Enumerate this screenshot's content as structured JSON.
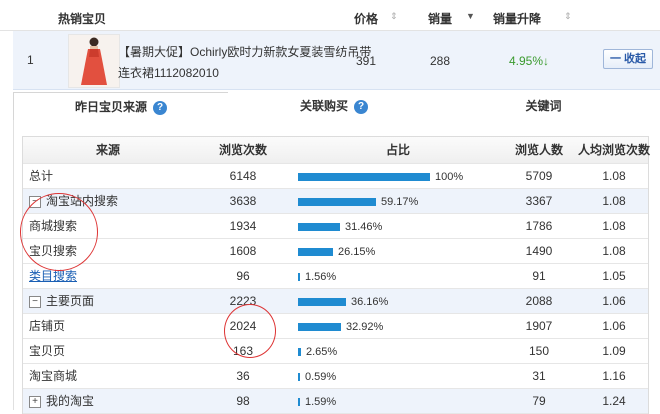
{
  "header": {
    "col_product": "热销宝贝",
    "col_price": "价格",
    "col_sales": "销量",
    "col_growth": "销量升降"
  },
  "product": {
    "rank": "1",
    "title_line1": "【暑期大促】Ochirly欧时力新款女夏装雪纺吊带",
    "title_line2": "连衣裙1112082010",
    "price": "391",
    "sales": "288",
    "growth": "4.95%",
    "collapse_label": "一 收起"
  },
  "tabs": [
    {
      "label": "昨日宝贝来源",
      "help": "?"
    },
    {
      "label": "关联购买",
      "help": "?"
    },
    {
      "label": "关键词"
    }
  ],
  "table": {
    "headers": [
      "来源",
      "浏览次数",
      "占比",
      "浏览人数",
      "人均浏览次数"
    ],
    "rows": [
      {
        "source": "总计",
        "pv": "6148",
        "share": "100%",
        "share_value": 100,
        "uv": "5709",
        "avg": "1.08",
        "type": "total"
      },
      {
        "source": "淘宝站内搜索",
        "pv": "3638",
        "share": "59.17%",
        "share_value": 59.17,
        "uv": "3367",
        "avg": "1.08",
        "type": "group",
        "toggle": "−"
      },
      {
        "source": "商城搜索",
        "pv": "1934",
        "share": "31.46%",
        "share_value": 31.46,
        "uv": "1786",
        "avg": "1.08",
        "type": "child"
      },
      {
        "source": "宝贝搜索",
        "pv": "1608",
        "share": "26.15%",
        "share_value": 26.15,
        "uv": "1490",
        "avg": "1.08",
        "type": "child"
      },
      {
        "source": "类目搜索",
        "pv": "96",
        "share": "1.56%",
        "share_value": 1.56,
        "uv": "91",
        "avg": "1.05",
        "type": "child",
        "link": true
      },
      {
        "source": "主要页面",
        "pv": "2223",
        "share": "36.16%",
        "share_value": 36.16,
        "uv": "2088",
        "avg": "1.06",
        "type": "group",
        "toggle": "−"
      },
      {
        "source": "店铺页",
        "pv": "2024",
        "share": "32.92%",
        "share_value": 32.92,
        "uv": "1907",
        "avg": "1.06",
        "type": "child"
      },
      {
        "source": "宝贝页",
        "pv": "163",
        "share": "2.65%",
        "share_value": 2.65,
        "uv": "150",
        "avg": "1.09",
        "type": "child"
      },
      {
        "source": "淘宝商城",
        "pv": "36",
        "share": "0.59%",
        "share_value": 0.59,
        "uv": "31",
        "avg": "1.16",
        "type": "child"
      },
      {
        "source": "我的淘宝",
        "pv": "98",
        "share": "1.59%",
        "share_value": 1.59,
        "uv": "79",
        "avg": "1.24",
        "type": "group",
        "toggle": "+"
      }
    ]
  },
  "colors": {
    "bar": "#1f8bd1",
    "growth": "#3a9a2e",
    "annotation": "#dd3333"
  }
}
